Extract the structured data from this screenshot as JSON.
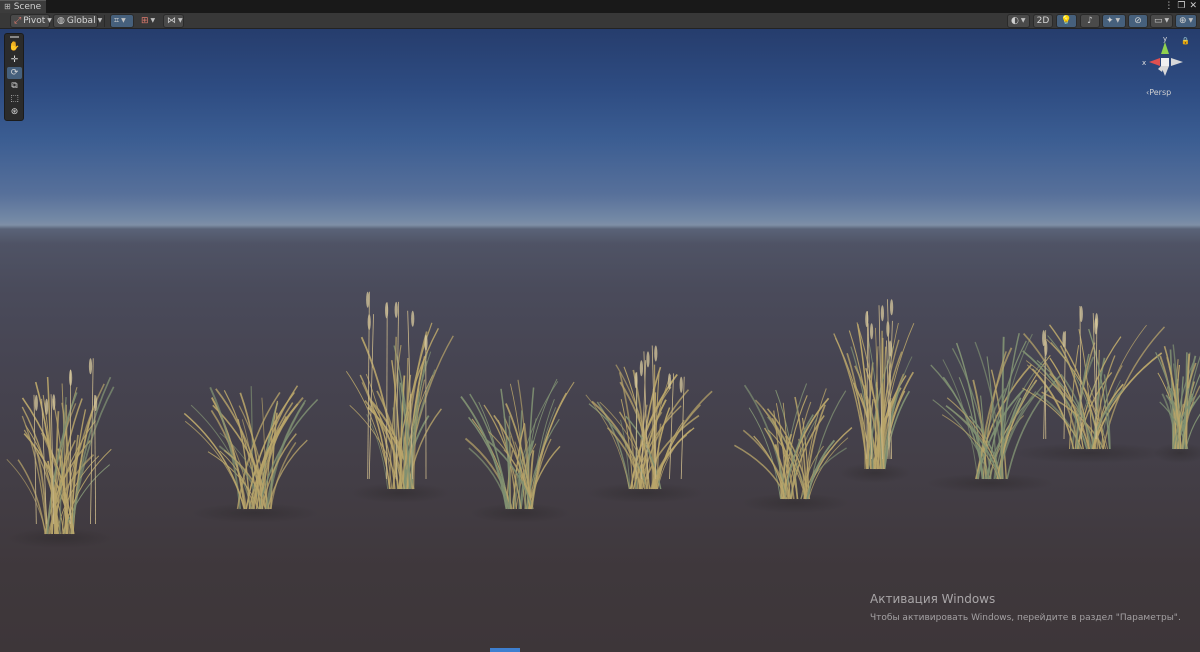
{
  "tab": {
    "icon": "grid-icon",
    "label": "Scene"
  },
  "window_controls": [
    "more-icon",
    "maximize-icon",
    "close-icon"
  ],
  "toolbar": {
    "pivot_label": "Pivot",
    "global_label": "Global",
    "mode_2d_label": "2D",
    "icons": [
      "move-pivot-icon",
      "globe-icon",
      "grid-snap-icon",
      "snap-increment-icon",
      "audio-icon",
      "shading-mode-icon",
      "lighting-icon",
      "audio-toggle-icon",
      "effects-icon",
      "hidden-objects-icon",
      "camera-icon",
      "gizmos-icon"
    ]
  },
  "tools": [
    "view-tool-hand-icon",
    "move-tool-icon",
    "rotate-tool-icon",
    "scale-tool-icon",
    "rect-tool-icon",
    "transform-tool-icon"
  ],
  "gizmo": {
    "x_label": "x",
    "y_label": "y",
    "view_label": "Persp"
  },
  "watermark": {
    "title": "Активация Windows",
    "subtitle": "Чтобы активировать Windows, перейдите в раздел \"Параметры\"."
  },
  "colors": {
    "accent": "#46607c",
    "sky_top": "#263d6d",
    "ground": "#3d3639",
    "grass_dry": "#b9a56a",
    "grass_green": "#7f9072"
  }
}
